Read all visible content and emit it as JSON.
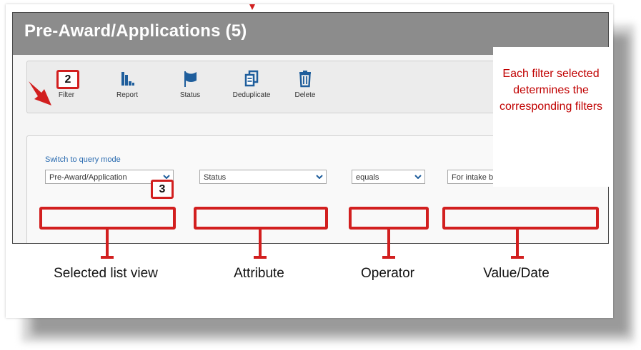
{
  "window": {
    "title": "Pre-Award/Applications (5)"
  },
  "toolbar": {
    "items": [
      {
        "label": "Filter",
        "icon": "funnel-icon"
      },
      {
        "label": "Report",
        "icon": "bar-chart-icon"
      },
      {
        "label": "Status",
        "icon": "flag-icon"
      },
      {
        "label": "Deduplicate",
        "icon": "copy-icon"
      },
      {
        "label": "Delete",
        "icon": "trash-icon"
      }
    ]
  },
  "filter_panel": {
    "query_link": "Switch to query mode",
    "selects": {
      "list_view": "Pre-Award/Application",
      "attribute": "Status",
      "operator": "equals",
      "value": "For intake by Research Service"
    }
  },
  "annotations": {
    "badges": [
      "2",
      "3"
    ],
    "note": "Each filter selected determines the corresponding filters",
    "captions": {
      "list_view": "Selected list view",
      "attribute": "Attribute",
      "operator": "Operator",
      "value": "Value/Date"
    }
  },
  "colors": {
    "header_bg": "#8c8c8c",
    "highlight_red": "#d21f1f",
    "note_red": "#c00000",
    "icon_blue": "#1f5e9c",
    "link_blue": "#2a6bb0"
  }
}
